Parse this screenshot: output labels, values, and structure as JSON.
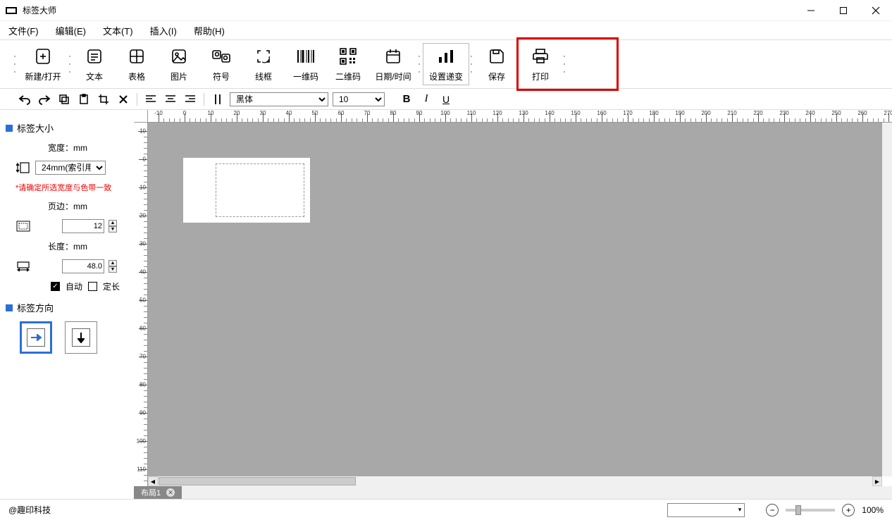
{
  "app": {
    "title": "标签大师"
  },
  "menu": {
    "file": "文件(F)",
    "edit": "编辑(E)",
    "text": "文本(T)",
    "insert": "插入(I)",
    "help": "帮助(H)"
  },
  "ribbon": {
    "new_open": "新建/打开",
    "text": "文本",
    "table": "表格",
    "image": "图片",
    "symbol": "符号",
    "frame": "线框",
    "barcode": "一维码",
    "qrcode": "二维码",
    "datetime": "日期/时间",
    "increment": "设置递变",
    "save": "保存",
    "print": "打印"
  },
  "format": {
    "font": "黑体",
    "size": "10",
    "bold": "B",
    "italic": "I",
    "underline": "U"
  },
  "sidebar": {
    "size_header": "标签大小",
    "width_label": "宽度：mm",
    "width_value": "24mm(索引用",
    "width_warn": "*请确定所选宽度与色带一致",
    "margin_label": "页边：mm",
    "margin_value": "12",
    "length_label": "长度：mm",
    "length_value": "48.0",
    "auto": "自动",
    "fixed": "定长",
    "orient_header": "标签方向"
  },
  "tab": {
    "name": "布局1"
  },
  "status": {
    "brand": "@趣印科技",
    "zoom": "100%"
  }
}
